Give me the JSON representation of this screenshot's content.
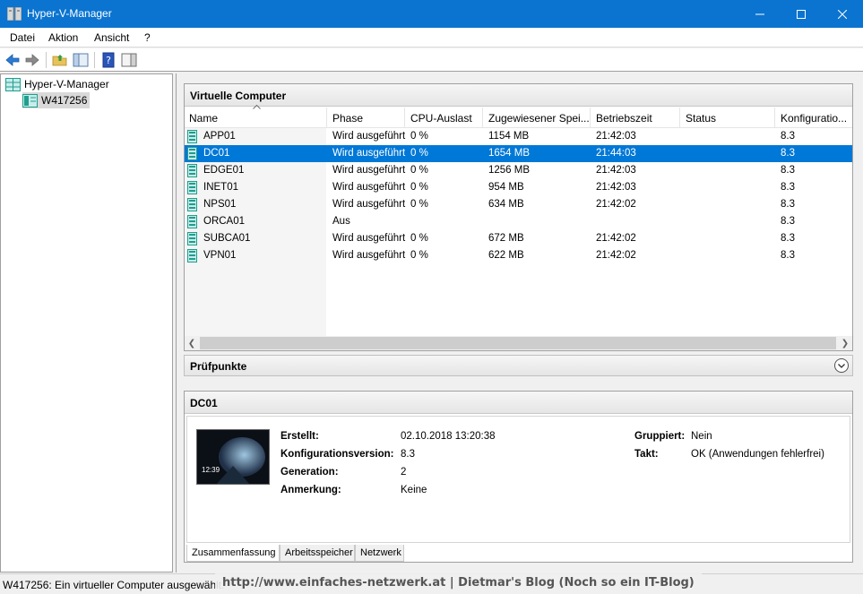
{
  "window": {
    "title": "Hyper-V-Manager"
  },
  "menu": {
    "items": [
      "Datei",
      "Aktion",
      "Ansicht",
      "?"
    ]
  },
  "tree": {
    "root": "Hyper-V-Manager",
    "host": "W417256"
  },
  "vm_section": {
    "title": "Virtuelle Computer",
    "columns": [
      "Name",
      "Phase",
      "CPU-Auslast",
      "Zugewiesener Spei...",
      "Betriebszeit",
      "Status",
      "Konfiguratio..."
    ],
    "rows": [
      {
        "name": "APP01",
        "phase": "Wird ausgeführt",
        "cpu": "0 %",
        "mem": "1154 MB",
        "uptime": "21:42:03",
        "status": "",
        "config": "8.3"
      },
      {
        "name": "DC01",
        "phase": "Wird ausgeführt",
        "cpu": "0 %",
        "mem": "1654 MB",
        "uptime": "21:44:03",
        "status": "",
        "config": "8.3"
      },
      {
        "name": "EDGE01",
        "phase": "Wird ausgeführt",
        "cpu": "0 %",
        "mem": "1256 MB",
        "uptime": "21:42:03",
        "status": "",
        "config": "8.3"
      },
      {
        "name": "INET01",
        "phase": "Wird ausgeführt",
        "cpu": "0 %",
        "mem": "954 MB",
        "uptime": "21:42:03",
        "status": "",
        "config": "8.3"
      },
      {
        "name": "NPS01",
        "phase": "Wird ausgeführt",
        "cpu": "0 %",
        "mem": "634 MB",
        "uptime": "21:42:02",
        "status": "",
        "config": "8.3"
      },
      {
        "name": "ORCA01",
        "phase": "Aus",
        "cpu": "",
        "mem": "",
        "uptime": "",
        "status": "",
        "config": "8.3"
      },
      {
        "name": "SUBCA01",
        "phase": "Wird ausgeführt",
        "cpu": "0 %",
        "mem": "672 MB",
        "uptime": "21:42:02",
        "status": "",
        "config": "8.3"
      },
      {
        "name": "VPN01",
        "phase": "Wird ausgeführt",
        "cpu": "0 %",
        "mem": "622 MB",
        "uptime": "21:42:02",
        "status": "",
        "config": "8.3"
      }
    ],
    "selected": "DC01"
  },
  "checkpoints": {
    "title": "Prüfpunkte"
  },
  "details": {
    "title": "DC01",
    "thumb_time": "12:39",
    "left": [
      {
        "label": "Erstellt:",
        "value": "02.10.2018 13:20:38"
      },
      {
        "label": "Konfigurationsversion:",
        "value": "8.3"
      },
      {
        "label": "Generation:",
        "value": "2"
      },
      {
        "label": "Anmerkung:",
        "value": "Keine"
      }
    ],
    "right": [
      {
        "label": "Gruppiert:",
        "value": "Nein"
      },
      {
        "label": "Takt:",
        "value": "OK (Anwendungen fehlerfrei)"
      }
    ],
    "tabs": [
      "Zusammenfassung",
      "Arbeitsspeicher",
      "Netzwerk"
    ]
  },
  "status": {
    "text": "W417256:  Ein virtueller Computer ausgewählt."
  },
  "watermark": "http://www.einfaches-netzwerk.at | Dietmar's Blog (Noch so ein IT-Blog)",
  "colors": {
    "titlebar": "#0a74d0",
    "selection": "#0078d7",
    "vm_icon": "#1f9e8c"
  }
}
